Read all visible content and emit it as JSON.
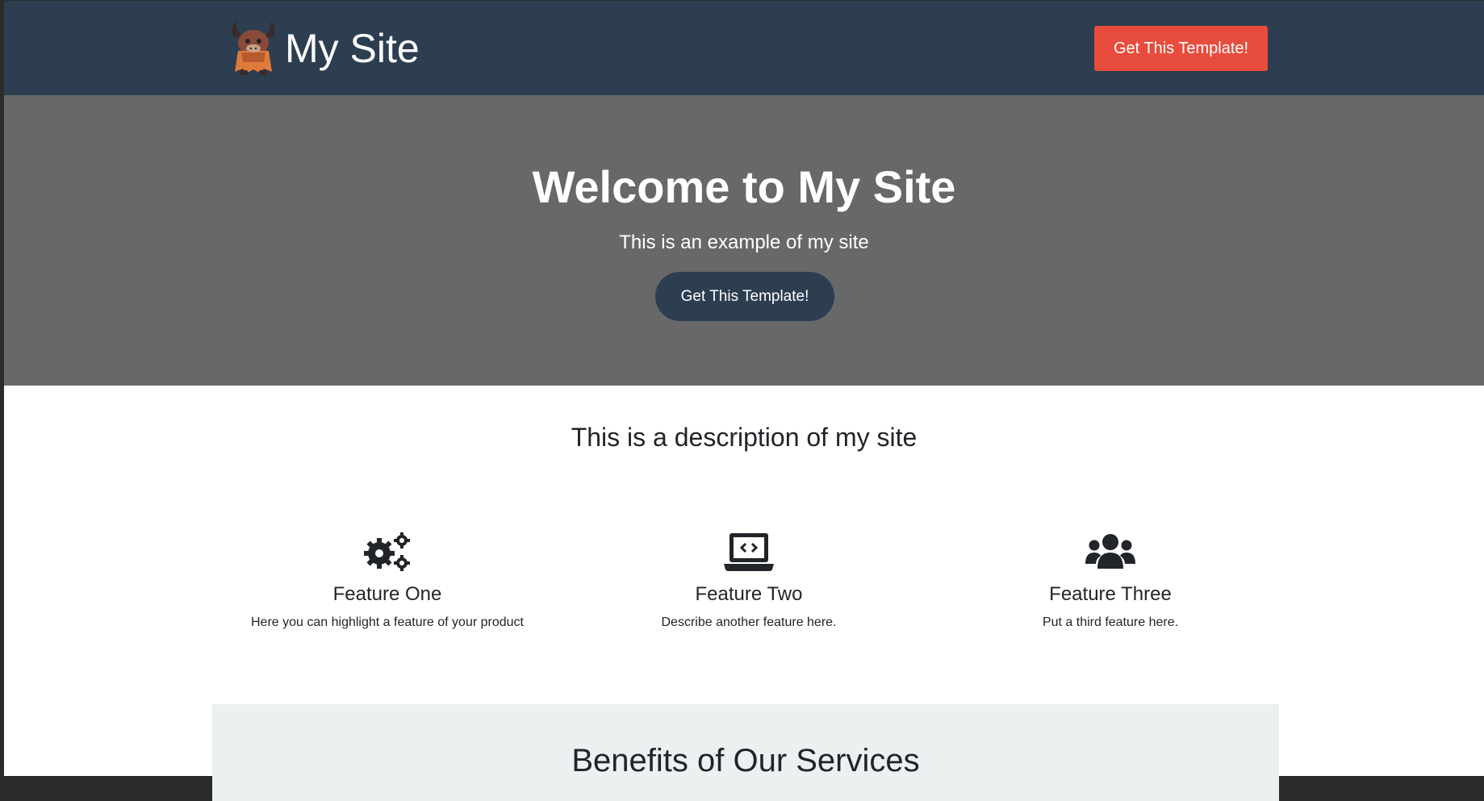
{
  "navbar": {
    "brand_name": "My Site",
    "logo_icon": "yak-mascot-icon",
    "cta_label": "Get This Template!",
    "background": "#2c3e50",
    "cta_color": "#e74c3c"
  },
  "hero": {
    "title": "Welcome to My Site",
    "subtitle": "This is an example of my site",
    "cta_label": "Get This Template!",
    "background": "#686868"
  },
  "description": {
    "text": "This is a description of my site"
  },
  "features": [
    {
      "icon": "gears-icon",
      "title": "Feature One",
      "text": "Here you can highlight a feature of your product"
    },
    {
      "icon": "laptop-code-icon",
      "title": "Feature Two",
      "text": "Describe another feature here."
    },
    {
      "icon": "users-icon",
      "title": "Feature Three",
      "text": "Put a third feature here."
    }
  ],
  "benefits": {
    "title": "Benefits of Our Services",
    "background": "#ecf0f1"
  }
}
